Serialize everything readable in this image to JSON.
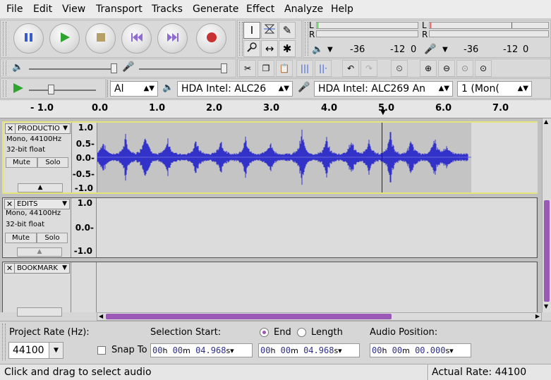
{
  "menu": [
    "File",
    "Edit",
    "View",
    "Transport",
    "Tracks",
    "Generate",
    "Effect",
    "Analyze",
    "Help"
  ],
  "meters": {
    "record": {
      "lr_top": "L",
      "lr_bottom": "R",
      "ticks": [
        "-36",
        "-12",
        "0"
      ]
    },
    "playback": {
      "lr_top": "L",
      "lr_bottom": "R",
      "ticks": [
        "-36",
        "-12",
        "0"
      ]
    }
  },
  "device": {
    "host": "Al",
    "playback_device": "HDA Intel: ALC26",
    "recording_device": "HDA Intel: ALC269 An",
    "channels": "1 (Mon("
  },
  "ruler": {
    "ticks": [
      "- 1.0",
      "0.0",
      "1.0",
      "2.0",
      "3.0",
      "4.0",
      "5.0",
      "6.0",
      "7.0"
    ]
  },
  "tracks": [
    {
      "name": "PRODUCTIO",
      "info1": "Mono, 44100Hz",
      "info2": "32-bit float",
      "mute": "Mute",
      "solo": "Solo",
      "scale": [
        "1.0",
        "0.5-",
        "0.0-",
        "-0.5-",
        "-1.0"
      ]
    },
    {
      "name": "EDITS",
      "info1": "Mono, 44100Hz",
      "info2": "32-bit float",
      "mute": "Mute",
      "solo": "Solo",
      "scale": [
        "1.0",
        "0.0-",
        "-1.0"
      ]
    },
    {
      "name": "BOOKMARK"
    }
  ],
  "selection": {
    "project_rate_label": "Project Rate (Hz):",
    "project_rate": "44100",
    "snap_to": "Snap To",
    "selection_start_label": "Selection Start:",
    "end_label": "End",
    "length_label": "Length",
    "audio_position_label": "Audio Position:",
    "start": {
      "h": "00",
      "m": "00",
      "s": "04.968"
    },
    "end": {
      "h": "00",
      "m": "00",
      "s": "04.968"
    },
    "position": {
      "h": "00",
      "m": "00",
      "s": "00.000"
    },
    "units": {
      "h": "h",
      "m": "m",
      "s": "s"
    }
  },
  "status": {
    "message": "Click and drag to select audio",
    "actual_rate": "Actual Rate: 44100"
  },
  "colors": {
    "wave": "#3232c8",
    "waveLight": "#6464e0",
    "selectedTrackBorder": "#e8e880",
    "scrollbar": "#9b59b6"
  },
  "icons": [
    "pause-icon",
    "play-icon",
    "stop-icon",
    "skip-start-icon",
    "skip-end-icon",
    "record-icon",
    "select-tool-icon",
    "envelope-tool-icon",
    "draw-tool-icon",
    "zoom-tool-icon",
    "timeshift-tool-icon",
    "multi-tool-icon",
    "speaker-icon",
    "microphone-icon",
    "cut-icon",
    "copy-icon",
    "paste-icon",
    "trim-icon",
    "silence-icon",
    "undo-icon",
    "redo-icon",
    "sync-lock-icon",
    "zoom-in-icon",
    "zoom-out-icon",
    "fit-selection-icon",
    "fit-project-icon",
    "play-at-speed-icon"
  ]
}
